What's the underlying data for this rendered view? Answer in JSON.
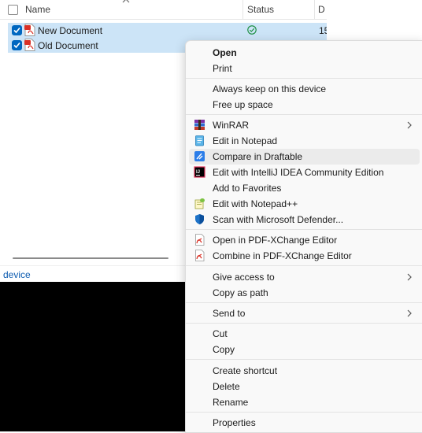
{
  "explorer": {
    "columns": {
      "name": "Name",
      "status": "Status",
      "date": "D"
    },
    "files": [
      {
        "name": "New Document",
        "date_fragment": "15"
      },
      {
        "name": "Old Document",
        "date_fragment": ""
      }
    ],
    "statusbar_text": "device"
  },
  "context_menu": {
    "items": [
      {
        "label": "Open",
        "icon": "",
        "submenu": false
      },
      {
        "label": "Print",
        "icon": "",
        "submenu": false
      },
      {
        "label": "Always keep on this device",
        "icon": "",
        "submenu": false
      },
      {
        "label": "Free up space",
        "icon": "",
        "submenu": false
      },
      {
        "label": "WinRAR",
        "icon": "winrar-icon",
        "submenu": true
      },
      {
        "label": "Edit in Notepad",
        "icon": "notepad-icon",
        "submenu": false
      },
      {
        "label": "Compare in Draftable",
        "icon": "draftable-icon",
        "submenu": false
      },
      {
        "label": "Edit with IntelliJ IDEA Community Edition",
        "icon": "intellij-icon",
        "submenu": false
      },
      {
        "label": "Add to Favorites",
        "icon": "",
        "submenu": false
      },
      {
        "label": "Edit with Notepad++",
        "icon": "notepad-plus-plus-icon",
        "submenu": false
      },
      {
        "label": "Scan with Microsoft Defender...",
        "icon": "defender-shield-icon",
        "submenu": false
      },
      {
        "label": "Open in PDF-XChange Editor",
        "icon": "pdf-xchange-icon",
        "submenu": false
      },
      {
        "label": "Combine in PDF-XChange Editor",
        "icon": "pdf-xchange-icon",
        "submenu": false
      },
      {
        "label": "Give access to",
        "icon": "",
        "submenu": true
      },
      {
        "label": "Copy as path",
        "icon": "",
        "submenu": false
      },
      {
        "label": "Send to",
        "icon": "",
        "submenu": true
      },
      {
        "label": "Cut",
        "icon": "",
        "submenu": false
      },
      {
        "label": "Copy",
        "icon": "",
        "submenu": false
      },
      {
        "label": "Create shortcut",
        "icon": "",
        "submenu": false
      },
      {
        "label": "Delete",
        "icon": "",
        "submenu": false
      },
      {
        "label": "Rename",
        "icon": "",
        "submenu": false
      },
      {
        "label": "Properties",
        "icon": "",
        "submenu": false
      }
    ],
    "highlighted_item": "Compare in Draftable"
  },
  "colors": {
    "selection": "#cce4f7",
    "checkbox": "#0067c0",
    "menu_background": "#f9f9f9",
    "menu_hover": "#ebebeb"
  }
}
